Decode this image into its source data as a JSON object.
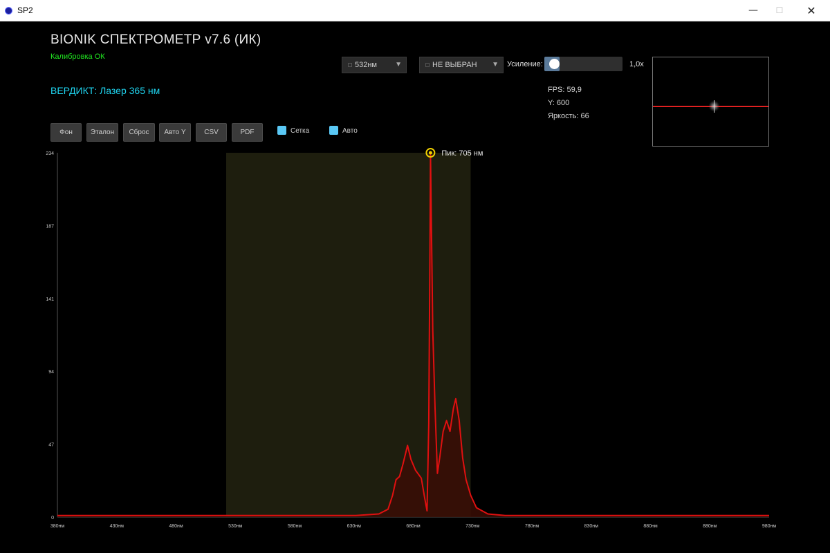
{
  "window": {
    "title": "SP2",
    "minimize": "—",
    "maximize": "☐",
    "close": "✕"
  },
  "header": {
    "title": "BIONIK СПЕКТРОМЕТР v7.6 (ИК)",
    "calibration": "Калибровка ОК",
    "verdict": "ВЕРДИКТ: Лазер 365 нм"
  },
  "controls": {
    "laser_select": {
      "value": "532нм"
    },
    "source_select": {
      "value": "НЕ ВЫБРАН"
    },
    "gain": {
      "label": "Усиление:",
      "value_text": "1,0х",
      "level": 0.07
    }
  },
  "stats": {
    "fps": "FPS: 59,9",
    "y": "Y: 600",
    "brightness": "Яркость: 66"
  },
  "toolbar": {
    "buttons": [
      "Фон",
      "Эталон",
      "Сброс",
      "Авто Y",
      "CSV",
      "PDF"
    ],
    "checkboxes": [
      {
        "label": "Сетка",
        "checked": true
      },
      {
        "label": "Авто",
        "checked": true
      }
    ]
  },
  "colors": {
    "accent": "#5ac8f5",
    "verdict": "#1fd5f0",
    "ok": "#21e821",
    "spectrum": "#e01010",
    "band": "#1e1e0e"
  },
  "chart_data": {
    "type": "area",
    "x_unit": "нм",
    "xlim": [
      380,
      1000
    ],
    "ylim": [
      0,
      234
    ],
    "y_ticks": [
      "234",
      "187",
      "141",
      "94",
      "47",
      "0"
    ],
    "x_ticks": [
      "380нм",
      "430нм",
      "480нм",
      "530нм",
      "580нм",
      "630нм",
      "680нм",
      "730нм",
      "780нм",
      "830нм",
      "880нм",
      "880нм",
      "980нм"
    ],
    "highlight_band": [
      527,
      740
    ],
    "peak_label": "Пик: 705 нм",
    "peak": {
      "x": 705,
      "y": 234
    },
    "series": [
      {
        "values": [
          [
            380,
            1
          ],
          [
            600,
            1
          ],
          [
            640,
            1
          ],
          [
            660,
            2
          ],
          [
            668,
            5
          ],
          [
            672,
            14
          ],
          [
            675,
            24
          ],
          [
            678,
            26
          ],
          [
            681,
            34
          ],
          [
            685,
            46
          ],
          [
            688,
            37
          ],
          [
            692,
            30
          ],
          [
            697,
            25
          ],
          [
            700,
            12
          ],
          [
            702,
            4
          ],
          [
            703.5,
            60
          ],
          [
            704.5,
            170
          ],
          [
            705,
            234
          ],
          [
            705.5,
            205
          ],
          [
            707,
            120
          ],
          [
            709,
            70
          ],
          [
            711,
            28
          ],
          [
            713,
            38
          ],
          [
            716,
            55
          ],
          [
            719,
            62
          ],
          [
            722,
            55
          ],
          [
            725,
            70
          ],
          [
            727,
            76
          ],
          [
            730,
            62
          ],
          [
            733,
            38
          ],
          [
            736,
            24
          ],
          [
            740,
            14
          ],
          [
            745,
            6
          ],
          [
            755,
            2
          ],
          [
            770,
            1
          ],
          [
            1000,
            1
          ]
        ]
      }
    ]
  }
}
